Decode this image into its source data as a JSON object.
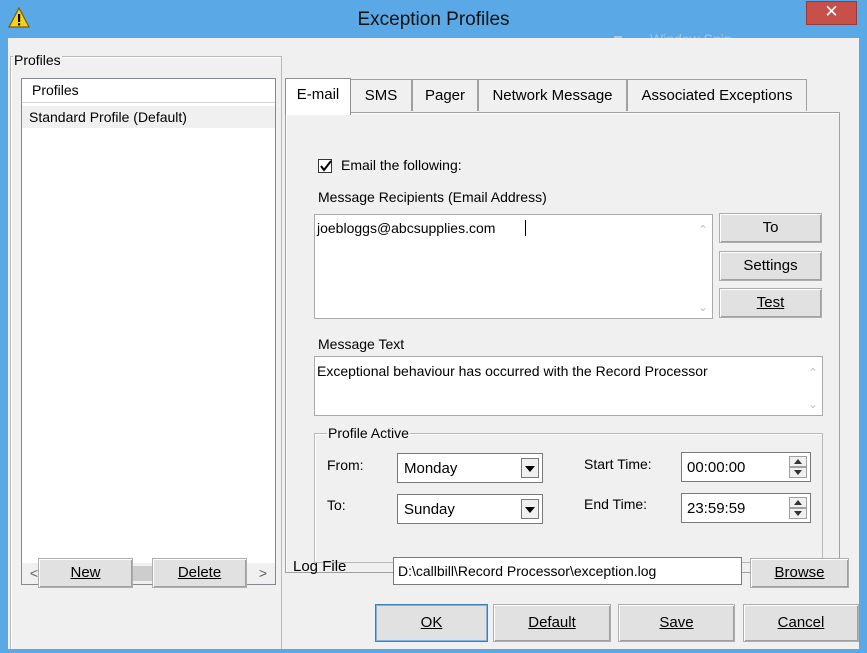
{
  "window": {
    "title": "Exception Profiles",
    "close_glyph": "✕",
    "warning_icon": "warning-triangle-icon",
    "background_ghost": "Window Snip"
  },
  "profiles": {
    "group_label": "Profiles",
    "column_header": "Profiles",
    "items": [
      "Standard Profile (Default)"
    ],
    "scroll_left": "<",
    "scroll_right": ">",
    "new_button": "New",
    "delete_button": "Delete"
  },
  "tabs": [
    {
      "label": "E-mail",
      "active": true
    },
    {
      "label": "SMS",
      "active": false
    },
    {
      "label": "Pager",
      "active": false
    },
    {
      "label": "Network Message",
      "active": false
    },
    {
      "label": "Associated Exceptions",
      "active": false
    }
  ],
  "email": {
    "enabled_label": "Email the following:",
    "enabled_checked": true,
    "recipients_label": "Message Recipients (Email Address)",
    "recipients_value": "joebloggs@abcsupplies.com",
    "to_button": "To",
    "settings_button": "Settings",
    "test_button": "Test",
    "message_label": "Message Text",
    "message_value": "Exceptional behaviour has occurred with the Record Processor"
  },
  "profile_active": {
    "group_label": "Profile Active",
    "from_label": "From:",
    "from_value": "Monday",
    "to_label": "To:",
    "to_value": "Sunday",
    "start_label": "Start Time:",
    "start_value": "00:00:00",
    "end_label": "End Time:",
    "end_value": "23:59:59"
  },
  "log_file": {
    "label": "Log File",
    "value": "D:\\callbill\\Record Processor\\exception.log",
    "browse_button": "Browse"
  },
  "footer": {
    "ok_button": "OK",
    "default_button": "Default",
    "save_button": "Save",
    "cancel_button": "Cancel"
  },
  "colors": {
    "titlebar": "#5aa9e6",
    "close": "#c7504a",
    "dialog": "#f0f0f0"
  }
}
